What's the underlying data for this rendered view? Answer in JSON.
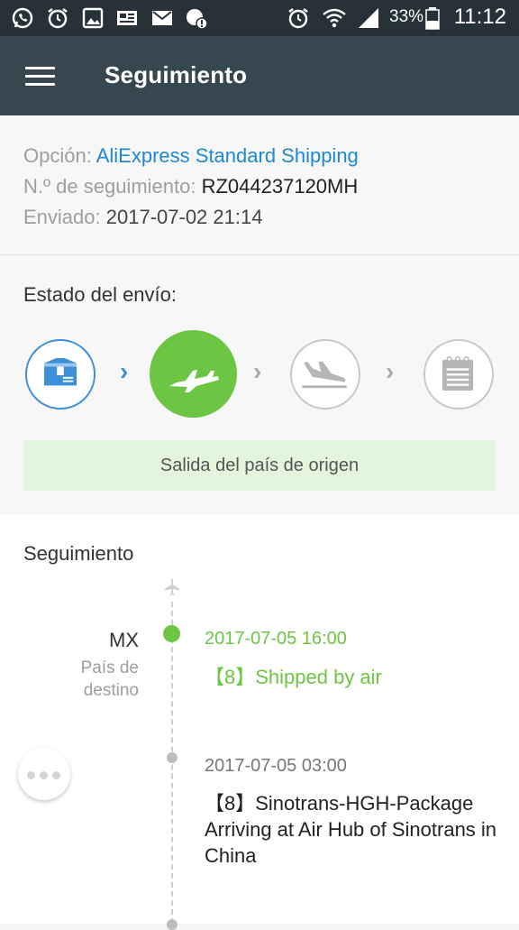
{
  "status_bar": {
    "battery": "33%",
    "time": "11:12"
  },
  "app_bar": {
    "title": "Seguimiento"
  },
  "shipment": {
    "option_label": "Opción:",
    "option_value": "AliExpress Standard Shipping",
    "tracking_label": "N.º de seguimiento:",
    "tracking_value": "RZ044237120MH",
    "sent_label": "Enviado:",
    "sent_value": "2017-07-02 21:14"
  },
  "shipping_status": {
    "label": "Estado del envío:",
    "current_step": 2,
    "total_steps": 4,
    "status_text": "Salida del país de origen"
  },
  "tracking": {
    "title": "Seguimiento",
    "location_code": "MX",
    "location_name": "País de destino",
    "events": [
      {
        "date": "2017-07-05 16:00",
        "description": "【8】Shipped by air"
      },
      {
        "date": "2017-07-05 03:00",
        "description": "【8】Sinotrans-HGH-Package Arriving at Air Hub of Sinotrans in China"
      }
    ]
  },
  "colors": {
    "status_bar": "#263238",
    "app_bar": "#37474f",
    "link": "#1e88d0",
    "active_green": "#6cc644",
    "step_blue": "#3d8fd8",
    "inactive_gray": "#b5b5b5",
    "status_box_bg": "#e3f5dc"
  },
  "icons": [
    "whatsapp-icon",
    "alarm-icon",
    "gallery-icon",
    "news-icon",
    "mail-icon",
    "security-icon",
    "alarm-clock-icon",
    "wifi-icon",
    "signal-icon",
    "battery-icon",
    "menu-icon",
    "package-icon",
    "plane-takeoff-icon",
    "plane-landing-icon",
    "delivered-icon",
    "airplane-icon",
    "more-icon"
  ]
}
